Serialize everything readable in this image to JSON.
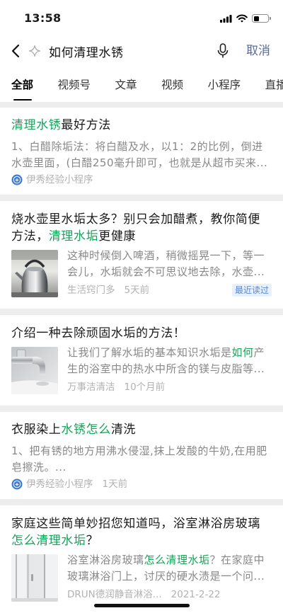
{
  "status_bar": {
    "time": "13:58",
    "battery_level": 0.4
  },
  "search": {
    "query": "如何清理水锈",
    "cancel_label": "取消"
  },
  "tabs": [
    {
      "label": "全部",
      "active": true
    },
    {
      "label": "视频号",
      "active": false
    },
    {
      "label": "文章",
      "active": false
    },
    {
      "label": "视频",
      "active": false
    },
    {
      "label": "小程序",
      "active": false
    },
    {
      "label": "直播",
      "active": false
    }
  ],
  "results": [
    {
      "title": [
        {
          "text": "清理水锈",
          "highlight": true
        },
        {
          "text": "最好方法",
          "highlight": false
        }
      ],
      "snippet": [
        {
          "text": "1、白醋除垢法：将白醋及水，以1：2的比例，倒进水壶里面，(白醋250毫升即可，也就是从超市买来...",
          "highlight": false
        }
      ],
      "source": {
        "icon": "mini-program-icon",
        "name": "伊秀经验小程序"
      }
    },
    {
      "title": [
        {
          "text": "烧水壶里水垢太多？别只会加醋煮，教你简便方法，",
          "highlight": false
        },
        {
          "text": "清理水垢",
          "highlight": true
        },
        {
          "text": "更健康",
          "highlight": false
        }
      ],
      "snippet": [
        {
          "text": "这种时候倒入啤酒，稍微摇晃一下，等一会儿，水垢就会不可思议地去除，水壶...",
          "highlight": false
        }
      ],
      "source": {
        "name": "生活窍门多",
        "time": "5天前"
      },
      "badge": "最近读过"
    },
    {
      "title": [
        {
          "text": "介绍一种去除顽固水垢的方法！",
          "highlight": false
        }
      ],
      "snippet": [
        {
          "text": "让我们了解水垢的基本知识水垢是",
          "highlight": false
        },
        {
          "text": "如何",
          "highlight": true
        },
        {
          "text": "产生的浴室中的热水中所含的镁与皮脂等...",
          "highlight": false
        }
      ],
      "source": {
        "name": "万事洁清洁",
        "time": "10个月前"
      }
    },
    {
      "title": [
        {
          "text": "衣服染上",
          "highlight": false
        },
        {
          "text": "水锈怎么",
          "highlight": true
        },
        {
          "text": "清洗",
          "highlight": false
        }
      ],
      "snippet": [
        {
          "text": "1、把有锈的地方用沸水侵湿,抹上发酸的牛奶,在用肥皂擦洗。...",
          "highlight": false
        }
      ],
      "source": {
        "icon": "mini-program-icon",
        "name": "伊秀经验小程序",
        "time": "1天前"
      }
    },
    {
      "title": [
        {
          "text": "家庭这些简单妙招您知道吗，浴室淋浴房玻璃",
          "highlight": false
        },
        {
          "text": "怎么清理水垢",
          "highlight": true
        },
        {
          "text": "？",
          "highlight": false
        }
      ],
      "snippet": [
        {
          "text": "浴室淋浴房玻璃",
          "highlight": false
        },
        {
          "text": "怎么清理水垢",
          "highlight": true
        },
        {
          "text": "？在家庭中玻璃淋浴门上，讨厌的硬水渍是一个问...",
          "highlight": false
        }
      ],
      "source": {
        "name": "DRUN德润静音淋浴...",
        "time": "2021-2-22"
      }
    }
  ],
  "colors": {
    "highlight": "#14a55a",
    "link": "#576b95",
    "badge_background": "#e8f1fb",
    "badge_text": "#5a87c8"
  }
}
